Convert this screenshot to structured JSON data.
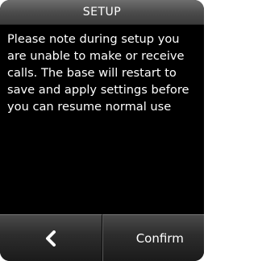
{
  "header": {
    "title": "SETUP"
  },
  "message": {
    "text": "Please note during setup you are unable to make or receive calls. The base will restart to save and apply settings before you can resume normal use"
  },
  "softkeys": {
    "left_icon": "back-chevron-icon",
    "right_label": "Confirm"
  },
  "colors": {
    "background": "#000000",
    "text": "#ffffff",
    "bar": "#4a4a4a"
  }
}
